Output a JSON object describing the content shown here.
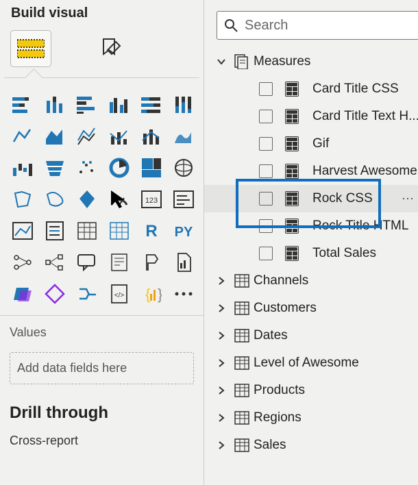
{
  "leftPane": {
    "title": "Build visual",
    "valuesLabel": "Values",
    "dropzonePlaceholder": "Add data fields here",
    "drillTitle": "Drill through",
    "crossReport": "Cross-report"
  },
  "search": {
    "placeholder": "Search"
  },
  "tree": {
    "topGroup": {
      "label": "Measures",
      "items": [
        {
          "label": "Card Title CSS"
        },
        {
          "label": "Card Title Text H..."
        },
        {
          "label": "Gif"
        },
        {
          "label": "Harvest Awesome"
        },
        {
          "label": "Rock CSS",
          "hovered": true
        },
        {
          "label": "Rock Title HTML"
        },
        {
          "label": "Total Sales"
        }
      ]
    },
    "tables": [
      {
        "label": "Channels"
      },
      {
        "label": "Customers"
      },
      {
        "label": "Dates"
      },
      {
        "label": "Level of Awesome"
      },
      {
        "label": "Products"
      },
      {
        "label": "Regions"
      },
      {
        "label": "Sales"
      }
    ]
  },
  "viz_icons": [
    "stacked-bar",
    "stacked-column",
    "clustered-bar",
    "clustered-column",
    "100-stacked-bar",
    "100-stacked-column",
    "line",
    "area",
    "stacked-area",
    "line-clustered-column",
    "line-stacked-column",
    "ribbon",
    "waterfall",
    "funnel",
    "scatter",
    "pie",
    "donut",
    "treemap-globe",
    "map",
    "filled-map",
    "azure-map",
    "gauge",
    "card-kpi",
    "table-matrix",
    "kpi",
    "slicer",
    "table",
    "matrix",
    "r",
    "py",
    "key-influencer",
    "decomposition",
    "qa",
    "smart-narrative",
    "paginated",
    "metrics",
    "power-apps",
    "power-automate",
    "more-a",
    "html-viz",
    "get-more",
    "ellipsis"
  ]
}
